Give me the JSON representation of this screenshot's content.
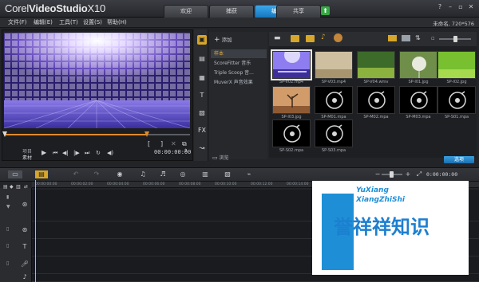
{
  "app": {
    "logo_text": "Corel",
    "logo_product": "VideoStudio",
    "logo_version": "X10",
    "project_info": "未命名, 720*576"
  },
  "steps": [
    {
      "label": "欢迎",
      "active": false
    },
    {
      "label": "捕获",
      "active": false
    },
    {
      "label": "编辑",
      "active": true
    },
    {
      "label": "共享",
      "active": false
    }
  ],
  "menu": [
    "文件(F)",
    "编辑(E)",
    "工具(T)",
    "设置(S)",
    "帮助(H)"
  ],
  "player": {
    "mode_project": "项目",
    "mode_clip": "素材",
    "timecode": "00:00:00:00",
    "bracket_in": "[",
    "bracket_out": "]"
  },
  "library": {
    "add_label": "添加",
    "categories": [
      {
        "label": "样本",
        "active": true
      },
      {
        "label": "ScoreFitter 音乐",
        "active": false
      },
      {
        "label": "Triple Scoop 音...",
        "active": false
      },
      {
        "label": "MuverX 声音效果",
        "active": false
      }
    ],
    "browse_label": "浏览",
    "option_label": "选项",
    "items": [
      {
        "label": "SP-V02.mp4",
        "kind": "video-stage",
        "selected": true
      },
      {
        "label": "SP-V03.mp4",
        "kind": "video-beige",
        "selected": false
      },
      {
        "label": "SP-V04.wmv",
        "kind": "video-green",
        "selected": false
      },
      {
        "label": "SP-I01.jpg",
        "kind": "photo-dandelion",
        "selected": false
      },
      {
        "label": "SP-I02.jpg",
        "kind": "photo-green",
        "selected": false
      },
      {
        "label": "SP-I03.jpg",
        "kind": "photo-tree",
        "selected": false
      },
      {
        "label": "SP-M01.mpa",
        "kind": "audio",
        "selected": false
      },
      {
        "label": "SP-M02.mpa",
        "kind": "audio",
        "selected": false
      },
      {
        "label": "SP-M03.mpa",
        "kind": "audio",
        "selected": false
      },
      {
        "label": "SP-S01.mpa",
        "kind": "audio",
        "selected": false
      },
      {
        "label": "SP-S02.mpa",
        "kind": "audio",
        "selected": false
      },
      {
        "label": "SP-S03.mpa",
        "kind": "audio",
        "selected": false
      }
    ]
  },
  "timeline": {
    "ruler_ticks": [
      "00:00:00:00",
      "00:00:02:00",
      "00:00:04:00",
      "00:00:06:00",
      "00:00:08:00",
      "00:00:10:00",
      "00:00:12:00",
      "00:00:14:00"
    ],
    "timecode": "0:00:00:00"
  },
  "watermark": {
    "line1": "YuXiang",
    "line2": "XiangZhiShi",
    "chinese": "誉祥祥知识"
  },
  "colors": {
    "accent_blue": "#1e8fd6",
    "active_tab": "#1576bf",
    "playhead": "#e9b33b"
  }
}
